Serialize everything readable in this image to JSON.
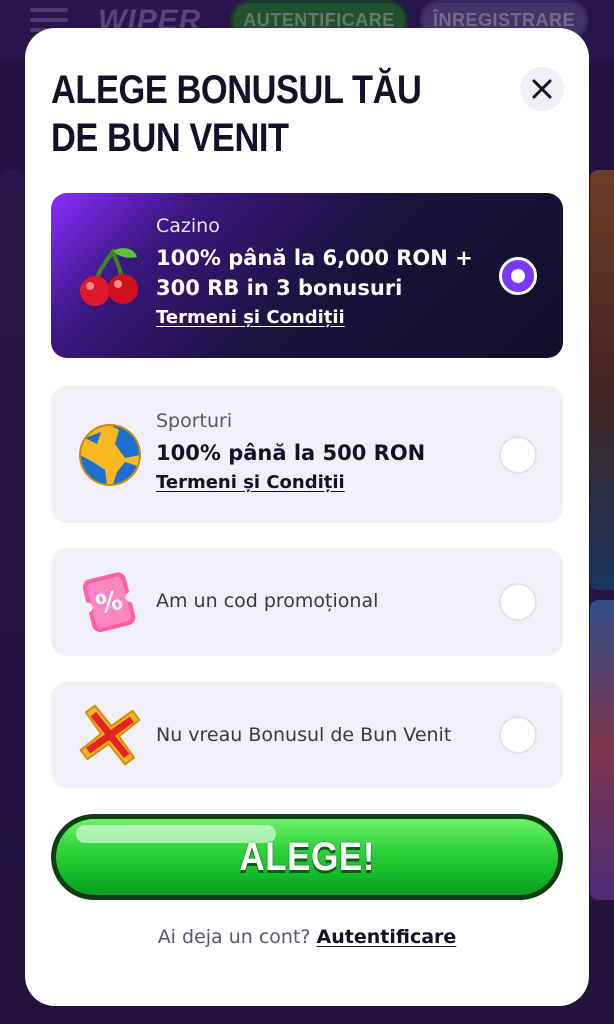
{
  "background": {
    "logo": "WIPER",
    "login_button": "AUTENTIFICARE",
    "register_button": "ÎNREGISTRARE"
  },
  "modal": {
    "title": "ALEGE BONUSUL TĂU DE BUN VENIT",
    "close_icon": "close-icon",
    "options": [
      {
        "category": "Cazino",
        "headline": "100% până la 6,000 RON + 300 RB in 3 bonusuri",
        "terms": "Termeni și Condiții",
        "icon": "cherries-icon",
        "selected": true
      },
      {
        "category": "Sporturi",
        "headline": "100% până la 500 RON",
        "terms": "Termeni și Condiții",
        "icon": "soccer-ball-icon",
        "selected": false
      },
      {
        "label": "Am un cod promoțional",
        "icon": "percent-ticket-icon",
        "selected": false
      },
      {
        "label": "Nu vreau Bonusul de Bun Venit",
        "icon": "red-x-icon",
        "selected": false
      }
    ],
    "cta_label": "ALEGE!",
    "footer_text": "Ai deja un cont?",
    "footer_link": "Autentificare"
  },
  "colors": {
    "selected_card": "#17133a",
    "accent_purple": "#7a38ff",
    "cta_green": "#2fd43a",
    "card_bg": "#f1f0f8"
  }
}
